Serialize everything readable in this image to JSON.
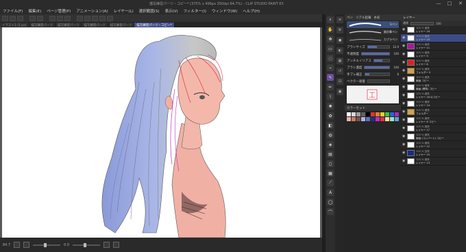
{
  "window": {
    "title": "描写練習パーツ・コピー* (375% x 496px 350dpi 84.7%) - CLIP STUDIO PAINT EX",
    "controls": [
      "—",
      "□",
      "✕"
    ]
  },
  "menu": [
    "ファイル(F)",
    "編集(E)",
    "ページ管理(P)",
    "アニメーション(A)",
    "レイヤー(L)",
    "選択範囲(S)",
    "表示(V)",
    "フィルター(I)",
    "ウィンドウ(W)",
    "ヘルプ(H)"
  ],
  "tabs": [
    {
      "label": "イラスト1 (1 px)",
      "active": false
    },
    {
      "label": "描写練習パーツ",
      "active": false
    },
    {
      "label": "描写練習パーツ",
      "active": false
    },
    {
      "label": "描写練習パーツ",
      "active": false
    },
    {
      "label": "描写練習パーツ",
      "active": false
    },
    {
      "label": "描写練習パーツ・コピー*",
      "active": true
    }
  ],
  "status": {
    "zoom": "84.7",
    "angle": "0.0"
  },
  "subtool": {
    "header": [
      "ペン",
      "リアル鉛筆",
      "水彩"
    ],
    "strokes": [
      {
        "name": "Gペン",
        "selected": true
      },
      {
        "name": "鋼芯筆ペン",
        "selected": false
      },
      {
        "name": "カブラペン",
        "selected": false
      }
    ],
    "properties": [
      {
        "label": "ブラシサイズ",
        "value": "12.0",
        "fill": 0.42
      },
      {
        "label": "不透明度",
        "value": "100",
        "fill": 1.0
      },
      {
        "label": "アンチエイリアス",
        "value": "",
        "fill": 0.55
      },
      {
        "label": "ブラシ濃度",
        "value": "100",
        "fill": 1.0
      },
      {
        "label": "手ブレ補正",
        "value": "6",
        "fill": 0.18
      },
      {
        "label": "ベクター吸着",
        "value": "",
        "fill": 0.0
      }
    ],
    "color_header": "カラーセット"
  },
  "layers": {
    "header": "レイヤー",
    "blend": "通常",
    "opacity": "100",
    "items": [
      {
        "name": "100 % 通常",
        "sub": "レイヤー 18",
        "active": false,
        "folder": false,
        "color": "#ffffff"
      },
      {
        "name": "100 % 通常",
        "sub": "レイヤー 19",
        "active": true,
        "folder": false,
        "color": "#ffffff"
      },
      {
        "name": "100 % 通常",
        "sub": "レイヤー 11",
        "active": false,
        "folder": false,
        "color": "#a21aa0"
      },
      {
        "name": "100 % 通常",
        "sub": "レイヤー 9",
        "active": false,
        "folder": false,
        "color": "#ffffff"
      },
      {
        "name": "100 % 通常",
        "sub": "レイヤー 8",
        "active": false,
        "folder": false,
        "color": "#e02020"
      },
      {
        "name": "100 % 通常",
        "sub": "フォルダー 5",
        "active": false,
        "folder": true,
        "color": "#c9a25b"
      },
      {
        "name": "100 % 通常",
        "sub": "線画 コピー",
        "active": false,
        "folder": false,
        "color": "#ffffff"
      },
      {
        "name": "100 % 通常",
        "sub": "線画 (標準) コピー",
        "active": false,
        "folder": false,
        "color": "#ffffff"
      },
      {
        "name": "100 % 通常",
        "sub": "レイヤー 16 のコピー",
        "active": false,
        "folder": false,
        "color": "#ffffff"
      },
      {
        "name": "100 % 通常",
        "sub": "レイヤー 14",
        "active": false,
        "folder": false,
        "color": "#ffffff"
      },
      {
        "name": "100 % 通常",
        "sub": "フォルダー",
        "active": false,
        "folder": true,
        "color": "#c9a25b"
      },
      {
        "name": "100 % 通常",
        "sub": "レイヤー 6 コピー",
        "active": false,
        "folder": false,
        "color": "#ffffff"
      },
      {
        "name": "100 % 通常",
        "sub": "レイヤー 17",
        "active": false,
        "folder": false,
        "color": "#ffffff"
      },
      {
        "name": "100 % 通常",
        "sub": "線画 (コンバート) コピー",
        "active": false,
        "folder": false,
        "color": "#ffffff"
      },
      {
        "name": "100 % 通常",
        "sub": "レイヤー 12",
        "active": false,
        "folder": false,
        "color": "#ffffff"
      },
      {
        "name": "100 % 加算",
        "sub": "レイヤー 15",
        "active": false,
        "folder": false,
        "color": "#1a2a8a"
      },
      {
        "name": "100 % 通常",
        "sub": "レイヤー 13",
        "active": false,
        "folder": false,
        "color": "#ffffff"
      }
    ]
  },
  "icons": {
    "tools": [
      "zoom-icon",
      "hand-icon",
      "move-icon",
      "select-icon",
      "lasso-icon",
      "eyedropper-icon",
      "pen-icon",
      "pencil-icon",
      "brush-icon",
      "airbrush-icon",
      "decoration-icon",
      "eraser-icon",
      "blend-icon",
      "fill-icon",
      "gradient-icon",
      "figure-icon",
      "frame-icon",
      "ruler-icon",
      "text-icon",
      "balloon-icon",
      "line-correct-icon"
    ]
  }
}
